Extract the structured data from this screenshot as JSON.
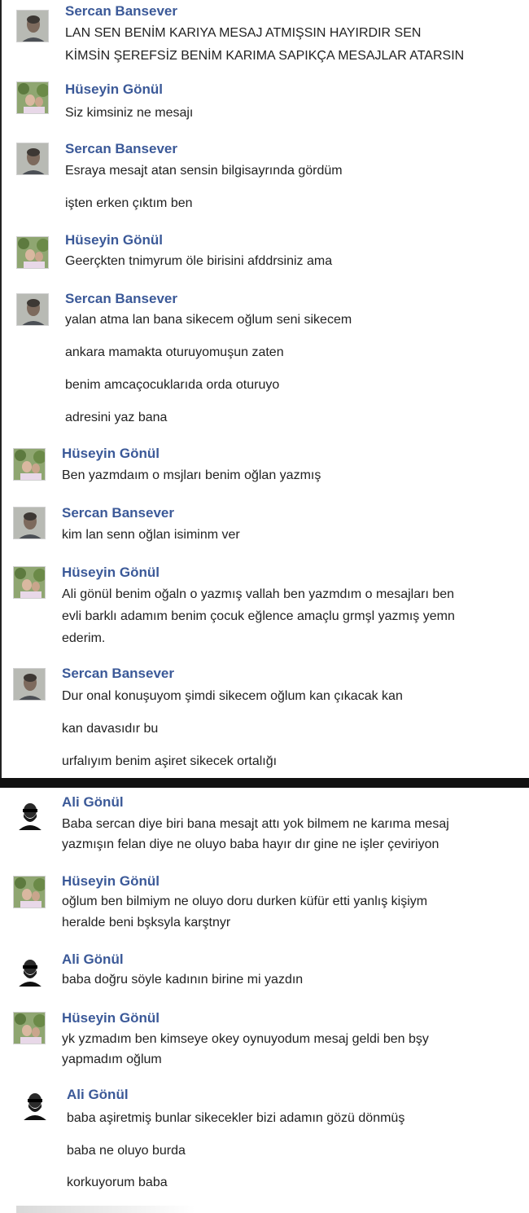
{
  "participants": {
    "sercan": "Sercan Bansever",
    "huseyin": "Hüseyin Gönül",
    "ali": "Ali Gönül"
  },
  "conversation_1": [
    {
      "sender": "Sercan Bansever",
      "avatar": "man-photo-avatar",
      "lines": [
        "LAN SEN BENİM KARIYA MESAJ ATMIŞSIN HAYIRDIR SEN",
        "KİMSİN ŞEREFSİZ BENİM KARIMA SAPIKÇA MESAJLAR ATARSIN"
      ]
    },
    {
      "sender": "Hüseyin Gönül",
      "avatar": "outdoor-photo-avatar",
      "lines": [
        "Siz kimsiniz ne mesajı"
      ]
    },
    {
      "sender": "Sercan Bansever",
      "avatar": "man-photo-avatar",
      "lines": [
        "Esraya mesajt atan sensin bilgisayrında gördüm",
        "işten erken çıktım ben"
      ]
    },
    {
      "sender": "Hüseyin Gönül",
      "avatar": "outdoor-photo-avatar",
      "lines": [
        "Geerçkten tnimyrum öle birisini afddrsiniz ama"
      ]
    },
    {
      "sender": "Sercan Bansever",
      "avatar": "man-photo-avatar",
      "lines": [
        "yalan atma lan bana sikecem oğlum seni sikecem",
        "ankara mamakta oturuyomuşun zaten",
        "benim amcaçocuklarıda orda oturuyo",
        "adresini yaz bana"
      ]
    },
    {
      "sender": "Hüseyin Gönül",
      "avatar": "outdoor-photo-avatar",
      "lines": [
        "Ben yazmdaım o msjları benim oğlan yazmış"
      ]
    },
    {
      "sender": "Sercan Bansever",
      "avatar": "man-photo-avatar",
      "lines": [
        "kim lan senn oğlan isiminm ver"
      ]
    },
    {
      "sender": "Hüseyin Gönül",
      "avatar": "outdoor-photo-avatar",
      "lines": [
        "Ali gönül benim oğaln o yazmış vallah ben yazmdım o mesajları ben",
        "evli barklı adamım benim çocuk eğlence amaçlu grmşl yazmış yemn",
        "ederim."
      ]
    },
    {
      "sender": "Sercan Bansever",
      "avatar": "man-photo-avatar",
      "lines": [
        "Dur onal konuşuyom şimdi sikecem oğlum kan çıkacak kan",
        "kan davasıdır bu",
        "urfalıyım benim aşiret sikecek ortalığı"
      ]
    }
  ],
  "conversation_2": [
    {
      "sender": "Ali Gönül",
      "avatar": "bearded-man-sunglasses-avatar",
      "lines": [
        "Baba sercan diye biri bana mesajt attı yok bilmem ne karıma mesaj",
        "yazmışın felan diye ne oluyo baba hayır dır gine ne işler çeviriyon"
      ]
    },
    {
      "sender": "Hüseyin Gönül",
      "avatar": "outdoor-photo-avatar",
      "lines": [
        "oğlum ben bilmiym ne oluyo doru durken küfür etti yanlış kişiym",
        "heralde beni bşksyla karştnyr"
      ]
    },
    {
      "sender": "Ali Gönül",
      "avatar": "bearded-man-sunglasses-avatar",
      "lines": [
        "baba doğru söyle kadının birine mi yazdın"
      ]
    },
    {
      "sender": "Hüseyin Gönül",
      "avatar": "outdoor-photo-avatar",
      "lines": [
        "yk yzmadım ben kimseye okey oynuyodum mesaj geldi ben bşy",
        "yapmadım oğlum"
      ]
    },
    {
      "sender": "Ali Gönül",
      "avatar": "bearded-man-sunglasses-avatar",
      "lines": [
        "baba aşiretmiş bunlar sikecekler bizi adamın gözü dönmüş",
        "baba ne oluyo burda",
        "korkuyorum baba"
      ]
    }
  ]
}
